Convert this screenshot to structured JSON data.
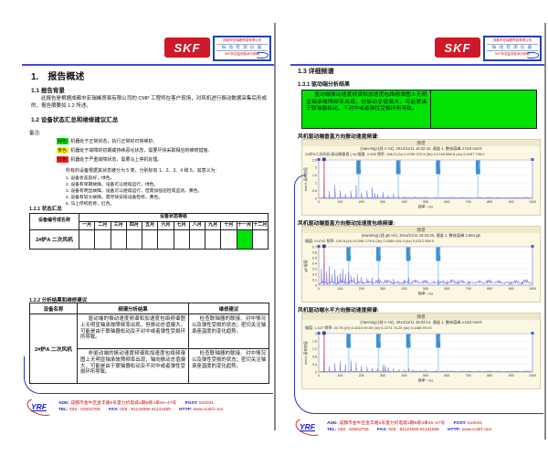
{
  "colors": {
    "skf_red": "#cf1928",
    "rule_blue": "#4a45d8",
    "swoosh_blue": "#2433c0",
    "status_green": "#00e304",
    "status_yellow": "#ffff00",
    "status_red": "#ff2020",
    "spectrum_blue": "#7b7bdd",
    "marker_blue": "#3d8fd4",
    "cursor_red": "#d04050"
  },
  "logo": {
    "skf": "SKF",
    "dist_line1": "成都市宏瑞峰贸易有限公司",
    "dist_line2": "振 动 检 测 仪 器",
    "dist_line3": "SKF状态监测技术分销商"
  },
  "left_page": {
    "h1": "1.　报告概述",
    "h1_1": "1.1 报告背景",
    "background_para": "此报告是根据成都市宏瑞峰贸易有限公司的 CMP 工程师在客户现场，对风机进行振动数据采集后形成的，报告摘要如 1.2 所述。",
    "h1_2": "1.2 设备状态汇总和维修建议汇总",
    "note_label": "备注:",
    "legend": [
      {
        "label": "绿色:",
        "color": "#00e304",
        "text": "机器处于正常状态，执行正常的日常维护。"
      },
      {
        "label": "黄色:",
        "color": "#ffff00",
        "text": "机器处于故障的初期或持续恶化状态，需要尽快采取相应的维修措施。"
      },
      {
        "label": "红色:",
        "color": "#ff2020",
        "text": "机器处于严重故障状态，需要马上停机处理。"
      }
    ],
    "class_intro": "所有的设备根据其状态被分为 5 类，分别标有 1、2、3、4 和 5，其意义为:",
    "class_items": [
      "1. 设备状态良好，绿色。",
      "2. 设备有早期故障，设备可以继续运行，绿色。",
      "3. 设备有明显故障，设备可以继续运行，但需加强巡检或监测，黄色。",
      "4. 设备有较大故障，需尽快安排设备检修，黄色。",
      "5. 马上停机检修，红色。"
    ],
    "h1_2_1": "1.2.1 状态汇总",
    "table1": {
      "col1_header": "设备编号或名称",
      "span_header": "设备状态等级",
      "months": [
        "一月",
        "二月",
        "三月",
        "四月",
        "五月",
        "六月",
        "七月",
        "八月",
        "九月",
        "十月",
        "十一月",
        "十二月"
      ],
      "device": "2#炉A 二次风机",
      "green_month_index": 10
    },
    "h1_2_2": "1.2.2 分析结果和维修建议",
    "table2": {
      "headers": [
        "设备名称",
        "频谱分析结果",
        "维修建议"
      ],
      "device": "2#炉A 二次风机",
      "rows": [
        {
          "result": "驱动端的振动速度频谱和加速度包络频谱图上无明显轴承故障频率出现，但振动总值偏大，可能是由于联轴器松动及不对中或者弹性受损环所导致。",
          "advice": "检查联轴器的联接、对中情况以及弹性受损的状态；密切关注轴承座温度的变化趋势。"
        },
        {
          "result": "非驱动端的振动速度频谱和加速度包络频谱图上无明显轴承故障频率出现，轴向振动总值偏大，可能是由于联轴器松动及不对中或者弹性受损环所导致。",
          "advice": "检查联轴器的联接、对中情况以及弹性受损的状态；密切关注轴承座温度的变化趋势。"
        }
      ]
    }
  },
  "right_page": {
    "h1_3": "1.3 详细频谱",
    "h1_3_1": "1.3.1 驱动端分析结果",
    "summary_box": "驱动端振动速度频谱和加速度包络频谱图上无明显轴承故障频率出现，但振动总值偏大，可能是由于联轴器松动、不对中或者弹性受损环所导致。",
    "chart_labels": [
      "风机驱动端垂直方向振动速度频谱:",
      "风机驱动端垂直方向振动加速度包络频谱:",
      "风机驱动端水平方向振动速度频谱:"
    ]
  },
  "footer": {
    "logo": "YRF",
    "add_label": "ADD:",
    "add_value": "成都市金牛区金丰路6号量力机电城1期B栋3单45~47号",
    "post_label": "POST:",
    "post_value": "610031",
    "tel_label": "TEL:",
    "tel_value": "028 - 82002766",
    "fax_label": "FAX:",
    "fax_value": "028 - 81134599 81131859",
    "http_label": "HTTP:",
    "http_value": "www.scskf.com"
  },
  "chart_data": [
    {
      "type": "line",
      "panel_title": "频谱",
      "header1": "(Hanning):(线 V Hz), 2014/11/11 16:32:42, 通道 1, 整体值峰 2.016 mm/s",
      "header2": "2#炉A二次风机-驱动端垂直 ( /s)  幅值: 0.026  频率: 186.3  (2x) 0.0765  372.5  (3x) 0.0745  558.8  (4x) 0.0437  745.0",
      "xlabel": "频率 - Hz",
      "ylabel": "mm/s 真有效值",
      "xlim": [
        0,
        1000
      ],
      "ylim": [
        0,
        2.5
      ],
      "xticks": [
        "0",
        "100",
        "200",
        "300",
        "400",
        "500",
        "600",
        "700",
        "800",
        "900",
        "1000"
      ],
      "yticks": [
        "2.5",
        "2",
        "1.5",
        "1",
        "0.5",
        "0"
      ],
      "grid": true,
      "noise": 0.06,
      "cursor": 25,
      "markers": [
        "186.3",
        "372.5",
        "558.8",
        "745.0"
      ],
      "peaks": [
        [
          25,
          2.3
        ],
        [
          50,
          0.45
        ],
        [
          75,
          0.85
        ],
        [
          100,
          0.5
        ],
        [
          125,
          0.3
        ],
        [
          150,
          0.5
        ],
        [
          175,
          0.85
        ],
        [
          200,
          0.38
        ],
        [
          225,
          0.52
        ],
        [
          250,
          0.7
        ],
        [
          262,
          0.35
        ],
        [
          275,
          0.28
        ],
        [
          300,
          0.42
        ],
        [
          325,
          0.18
        ],
        [
          350,
          0.3
        ],
        [
          375,
          0.14
        ],
        [
          400,
          0.1
        ],
        [
          425,
          0.08
        ],
        [
          450,
          0.12
        ],
        [
          475,
          0.07
        ],
        [
          500,
          0.1
        ],
        [
          550,
          0.08
        ],
        [
          600,
          0.06
        ],
        [
          650,
          0.05
        ],
        [
          700,
          0.05
        ],
        [
          750,
          0.05
        ],
        [
          800,
          0.04
        ],
        [
          850,
          0.04
        ],
        [
          900,
          0.03
        ]
      ]
    },
    {
      "type": "line",
      "panel_title": "频谱",
      "header1": "(Hanning):(线 gE Hz), 2014/11/11 16:34:26, 通道 1, 整体值峰 2.694 gE",
      "header2": "幅值: 0.0742  频率: 139.8  (2x) 0.0391  279.5  (3x) 0.0355  419.3  (4x) 0.0312  559.0",
      "xlabel": "频率 - Hz",
      "ylabel": "gE 幅值",
      "xlim": [
        0,
        1000
      ],
      "ylim": [
        0,
        0.7
      ],
      "xticks": [
        "0",
        "100",
        "200",
        "300",
        "400",
        "500",
        "600",
        "700",
        "800",
        "900",
        "1000"
      ],
      "yticks": [
        "0.7",
        "0.6",
        "0.5",
        "0.4",
        "0.3",
        "0.2",
        "0.1",
        "0"
      ],
      "grid": true,
      "noise": 0.085,
      "cursor": 25,
      "markers": [
        "139.8",
        "279.5",
        "419.3",
        "559.0"
      ],
      "peaks": [
        [
          12,
          0.3
        ],
        [
          25,
          0.63
        ],
        [
          37,
          0.25
        ],
        [
          50,
          0.35
        ],
        [
          62,
          0.2
        ],
        [
          75,
          0.28
        ],
        [
          87,
          0.18
        ],
        [
          100,
          0.22
        ],
        [
          112,
          0.3
        ],
        [
          125,
          0.2
        ],
        [
          140,
          0.25
        ],
        [
          150,
          0.18
        ],
        [
          165,
          0.15
        ],
        [
          180,
          0.2
        ],
        [
          200,
          0.15
        ],
        [
          225,
          0.12
        ],
        [
          250,
          0.14
        ],
        [
          280,
          0.12
        ],
        [
          310,
          0.1
        ],
        [
          350,
          0.12
        ],
        [
          400,
          0.1
        ],
        [
          420,
          0.14
        ],
        [
          450,
          0.1
        ],
        [
          500,
          0.09
        ],
        [
          560,
          0.1
        ],
        [
          600,
          0.08
        ],
        [
          650,
          0.09
        ],
        [
          700,
          0.08
        ],
        [
          750,
          0.07
        ],
        [
          800,
          0.08
        ],
        [
          850,
          0.07
        ],
        [
          900,
          0.07
        ],
        [
          950,
          0.06
        ]
      ]
    },
    {
      "type": "line",
      "panel_title": "频谱",
      "header1": "(Hanning):(线 V Hz), 2014/11/11 16:33:14, 通道 1, 整体值峰 1.523 mm/s",
      "header2": "幅值: 1.437  频率: 24.75  (2x) 0.4315  49.50  (3x) 0.2274  74.25  (4x) 0.1188  99.00",
      "xlabel": "频率 - Hz",
      "ylabel": "mm/s 真有效值",
      "xlim": [
        0,
        1000
      ],
      "ylim": [
        0,
        2
      ],
      "xticks": [
        "0",
        "100",
        "200",
        "300",
        "400",
        "500",
        "600",
        "700",
        "800",
        "900",
        "1000"
      ],
      "yticks": [
        "2",
        "1.6",
        "1.2",
        "0.8",
        "0.4",
        "0"
      ],
      "grid": true,
      "noise": 0.05,
      "cursor": 25,
      "markers": [
        "139.8",
        "279.5",
        "419.3",
        "559.0"
      ],
      "peaks": [
        [
          25,
          1.9
        ],
        [
          50,
          0.3
        ],
        [
          75,
          0.45
        ],
        [
          100,
          0.55
        ],
        [
          125,
          0.4
        ],
        [
          150,
          0.65
        ],
        [
          175,
          0.5
        ],
        [
          200,
          0.32
        ],
        [
          225,
          0.28
        ],
        [
          250,
          0.22
        ],
        [
          275,
          0.18
        ],
        [
          300,
          0.4
        ],
        [
          310,
          0.35
        ],
        [
          325,
          0.25
        ],
        [
          350,
          0.2
        ],
        [
          375,
          0.15
        ],
        [
          400,
          0.12
        ],
        [
          420,
          0.18
        ],
        [
          440,
          0.12
        ],
        [
          475,
          0.1
        ],
        [
          500,
          0.1
        ],
        [
          550,
          0.08
        ],
        [
          600,
          0.07
        ],
        [
          700,
          0.05
        ],
        [
          800,
          0.04
        ],
        [
          900,
          0.04
        ]
      ]
    }
  ]
}
